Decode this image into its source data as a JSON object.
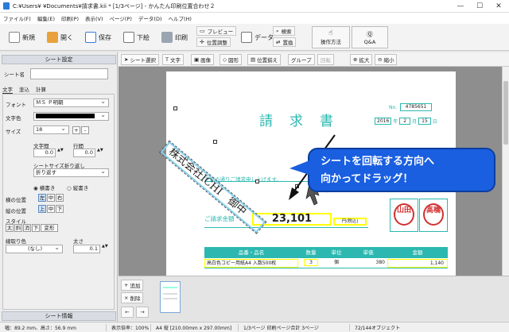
{
  "window": {
    "title": "C:¥Users¥    ¥Documents¥請求書.kii * [1/3ページ] - かんたん印刷位置合わせ２",
    "minimize": "—",
    "maximize": "☐",
    "close": "✕"
  },
  "menu": [
    "ファイル(F)",
    "編集(E)",
    "印刷(P)",
    "表示(V)",
    "ページ(P)",
    "データ(D)",
    "ヘルプ(H)"
  ],
  "ribbon": {
    "new": "新規",
    "open": "開く",
    "save": "保存",
    "import": "下絵",
    "print": "印刷",
    "preview": "プレビュー",
    "position_adjust": "位置調整",
    "data": "データ",
    "search": "検索",
    "replace": "置換",
    "howto": "操作方法",
    "qa": "Q&A"
  },
  "sheet_settings": {
    "header": "シート設定",
    "name_label": "シート名",
    "name_value": "",
    "tabs": [
      "文字",
      "塗込",
      "計算"
    ],
    "font_label": "フォント",
    "font_value": "ＭＳ Ｐ明朝",
    "color_label": "文字色",
    "size_label": "サイズ",
    "size_value": "18",
    "size_plus": "+",
    "size_minus": "-",
    "char_spacing_label": "文字間",
    "char_spacing_value": "0.0",
    "line_spacing_label": "行間",
    "line_spacing_value": "0.0",
    "wrap_label": "シートサイズ折り返し",
    "wrap_value": "折り返す",
    "horizontal": "横書き",
    "vertical": "縦書き",
    "halign_label": "横の位置",
    "halign": [
      "左",
      "中",
      "右"
    ],
    "valign_label": "縦の位置",
    "valign": [
      "上",
      "中",
      "下"
    ],
    "style_label": "スタイル",
    "style": [
      "太",
      "斜",
      "消",
      "下",
      "変形"
    ],
    "border_color_label": "線取り色",
    "border_color_value": "(なし)",
    "thickness_label": "太さ",
    "thickness_value": "0.1",
    "info_header": "シート情報"
  },
  "toolbar2": {
    "select": "シート選択",
    "text": "文字",
    "image": "画像",
    "shape": "図形",
    "align": "位置揃え",
    "group": "グループ",
    "rotate": "回転",
    "zoom_in": "拡大",
    "zoom_out": "縮小"
  },
  "invoice": {
    "title": "請　求　書",
    "no_label": "No.",
    "no_value": "4785651",
    "date_year": "2016",
    "date_year_unit": "年",
    "date_month": "2",
    "date_month_unit": "月",
    "date_day": "15",
    "date_day_unit": "日",
    "company": "株式会社ICHI　御中",
    "message": "下記の通りご請求申し上げます。",
    "amount_label": "ご請求金額",
    "amount_value": "23,101",
    "amount_unit": "円(税込)",
    "stamp1": "山田",
    "stamp2": "高橋",
    "table_headers": [
      "品番・品名",
      "数量",
      "単位",
      "単価",
      "金額"
    ],
    "row": {
      "name": "高白色コピー用紙A4 入数500枚",
      "qty": "3",
      "unit": "個",
      "price": "380",
      "amount": "1,140"
    }
  },
  "callout": {
    "line1": "シートを回転する方向へ",
    "line2": "向かってドラッグ！"
  },
  "page_ops": {
    "add": "追加",
    "delete": "削除",
    "prev": "←",
    "next": "→"
  },
  "status": [
    "幅：89.2 mm、高さ：56.9 mm",
    "表示倍率：100%",
    "A4 縦 [210.00mm x 297.00mm]",
    "1/3ページ 印刷ページ合計 3ページ",
    "72/144オブジェクト"
  ],
  "colors": {
    "accent": "#2cb8b0",
    "highlight": "#ffff00",
    "callout": "#1a5fe0",
    "stamp": "#d23030"
  }
}
